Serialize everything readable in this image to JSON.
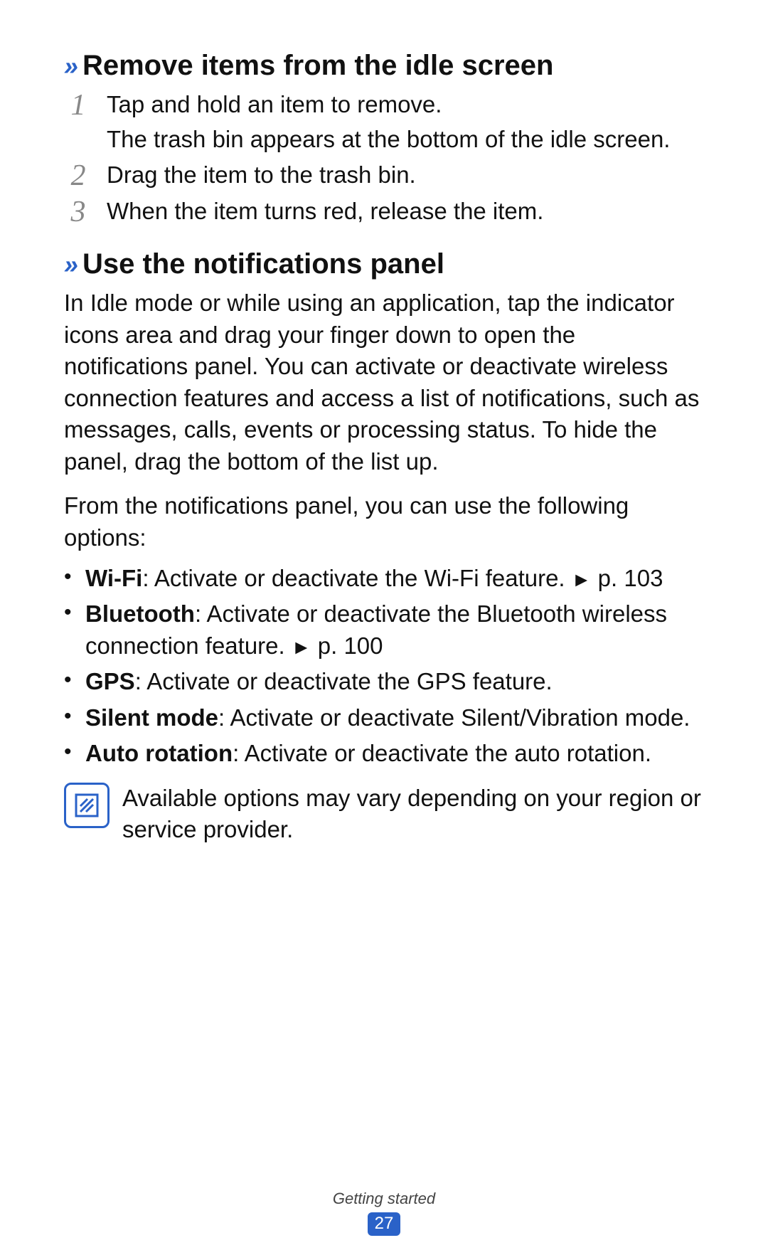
{
  "section1": {
    "chevrons": "››",
    "title": "Remove items from the idle screen",
    "steps": [
      {
        "num": "1",
        "line1": "Tap and hold an item to remove.",
        "line2": "The trash bin appears at the bottom of the idle screen."
      },
      {
        "num": "2",
        "line1": "Drag the item to the trash bin."
      },
      {
        "num": "3",
        "line1": "When the item turns red, release the item."
      }
    ]
  },
  "section2": {
    "chevrons": "››",
    "title": "Use the notifications panel",
    "intro": "In Idle mode or while using an application, tap the indicator icons area and drag your finger down to open the notifications panel. You can activate or deactivate wireless connection features and access a list of notifications, such as messages, calls, events or processing status. To hide the panel, drag the bottom of the list up.",
    "options_lead": "From the notifications panel, you can use the following options:",
    "options": [
      {
        "bold": "Wi-Fi",
        "rest": ": Activate or deactivate the Wi-Fi feature. ",
        "arrow": "►",
        "page_ref": " p. 103"
      },
      {
        "bold": "Bluetooth",
        "rest": ": Activate or deactivate the Bluetooth wireless connection feature. ",
        "arrow": "►",
        "page_ref": " p. 100"
      },
      {
        "bold": "GPS",
        "rest": ": Activate or deactivate the GPS feature."
      },
      {
        "bold": "Silent mode",
        "rest": ": Activate or deactivate Silent/Vibration mode."
      },
      {
        "bold": "Auto rotation",
        "rest": ": Activate or deactivate the auto rotation."
      }
    ],
    "note": "Available options may vary depending on your region or service provider."
  },
  "footer": {
    "section_label": "Getting started",
    "page_number": "27"
  }
}
